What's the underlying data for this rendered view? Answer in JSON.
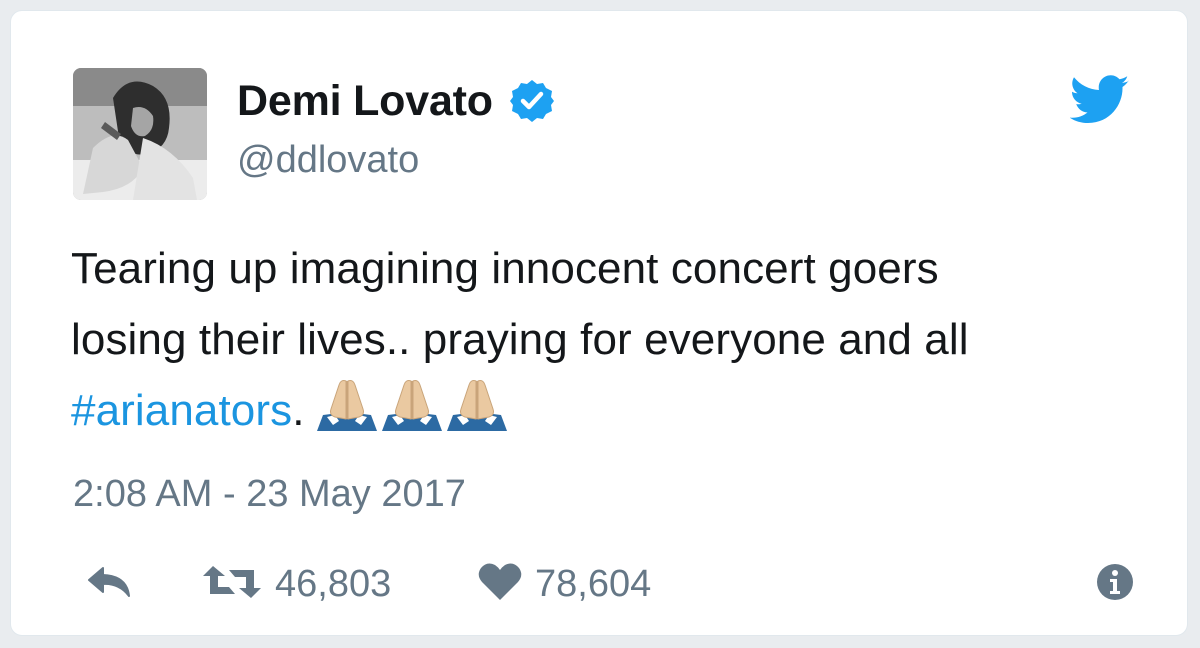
{
  "tweet": {
    "author": {
      "display_name": "Demi Lovato",
      "handle": "@ddlovato",
      "verified": true
    },
    "text": {
      "line1": "Tearing up imagining innocent concert goers",
      "line2": "losing their lives.. praying for everyone and all",
      "hashtag": "#arianators",
      "after_hashtag": ".",
      "emojis": [
        "folded-hands-emoji",
        "folded-hands-emoji",
        "folded-hands-emoji"
      ]
    },
    "timestamp": "2:08 AM - 23 May 2017",
    "actions": {
      "retweets": "46,803",
      "likes": "78,604"
    }
  },
  "icons": {
    "reply": "reply-icon",
    "retweet": "retweet-icon",
    "like": "heart-icon",
    "info": "info-icon",
    "brand": "twitter-bird-icon",
    "verified": "verified-badge-icon"
  },
  "colors": {
    "brand": "#1da1f2",
    "hashtag": "#1b95e0",
    "muted": "#657786",
    "text": "#14171a"
  }
}
